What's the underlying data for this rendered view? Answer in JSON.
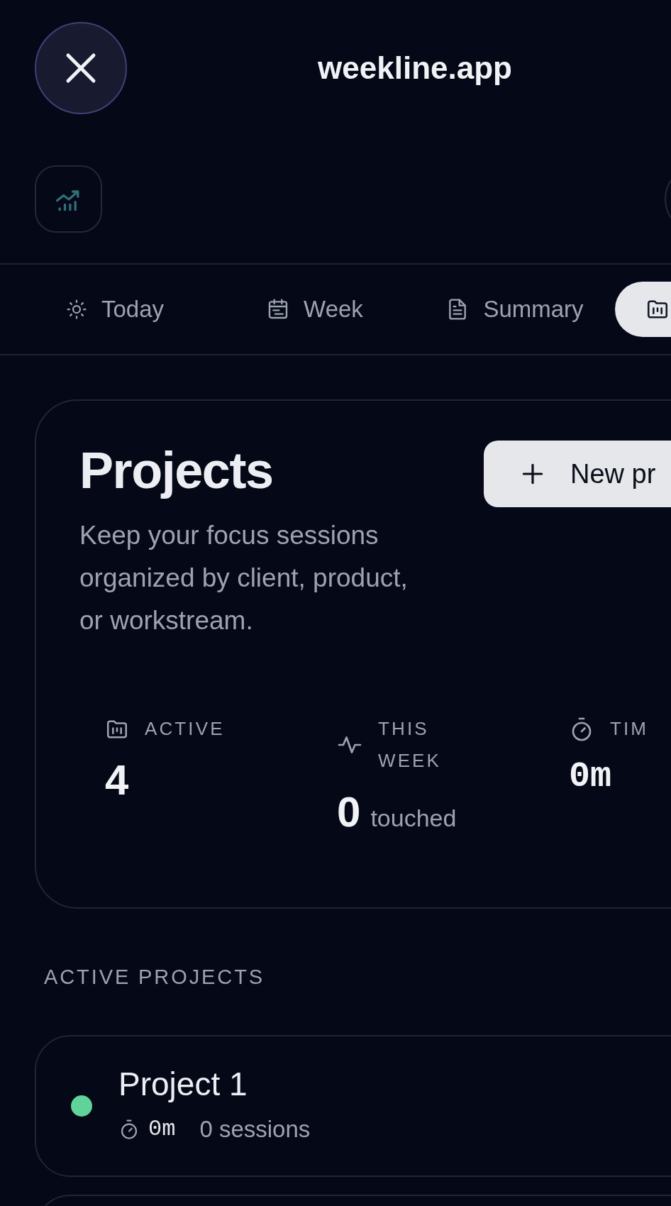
{
  "header": {
    "title": "weekline.app"
  },
  "tabs": [
    {
      "label": "Today",
      "selected": false
    },
    {
      "label": "Week",
      "selected": false
    },
    {
      "label": "Summary",
      "selected": false
    },
    {
      "selected": true
    }
  ],
  "overview": {
    "title": "Projects",
    "description": "Keep your focus sessions organized by client, product, or workstream.",
    "button": "New pr"
  },
  "stats": [
    {
      "kind": "count",
      "label": "ACTIVE",
      "value": "4"
    },
    {
      "kind": "count",
      "label": "THIS WEEK",
      "value": "0",
      "unit": "touched"
    },
    {
      "kind": "duration",
      "label": "TIM",
      "value": "0m"
    }
  ],
  "section_title": "ACTIVE PROJECTS",
  "projects": [
    {
      "name": "Project 1",
      "color": "#5fd39a",
      "time": "0m",
      "sessions": "0 sessions"
    }
  ]
}
